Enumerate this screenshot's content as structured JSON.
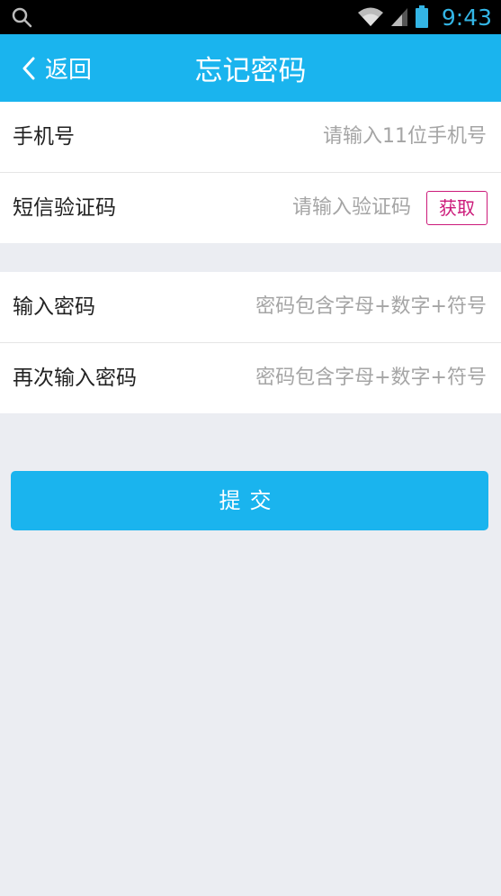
{
  "status_bar": {
    "time": "9:43",
    "icons": [
      "search-icon",
      "wifi-icon",
      "signal-icon",
      "battery-icon"
    ]
  },
  "header": {
    "back_label": "返回",
    "title": "忘记密码"
  },
  "form": {
    "phone": {
      "label": "手机号",
      "placeholder": "请输入11位手机号"
    },
    "sms": {
      "label": "短信验证码",
      "placeholder": "请输入验证码",
      "get_code_label": "获取"
    },
    "password": {
      "label": "输入密码",
      "placeholder": "密码包含字母+数字+符号"
    },
    "password_confirm": {
      "label": "再次输入密码",
      "placeholder": "密码包含字母+数字+符号"
    }
  },
  "submit_label": "提交",
  "colors": {
    "accent": "#1ab4ee",
    "get_code_border": "#cc1a7a",
    "background": "#ebedf2"
  }
}
